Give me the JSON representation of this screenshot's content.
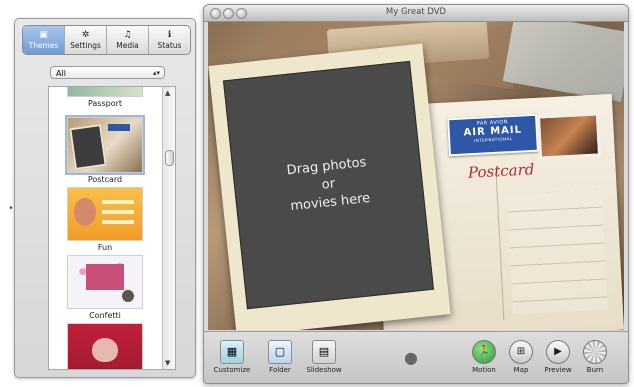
{
  "drawer": {
    "tabs": [
      {
        "label": "Themes",
        "icon": "themes-icon",
        "active": true
      },
      {
        "label": "Settings",
        "icon": "gear-icon",
        "active": false
      },
      {
        "label": "Media",
        "icon": "media-icon",
        "active": false
      },
      {
        "label": "Status",
        "icon": "info-icon",
        "active": false
      }
    ],
    "filter_value": "All",
    "themes": [
      {
        "label": "Passport"
      },
      {
        "label": "Postcard",
        "selected": true
      },
      {
        "label": "Fun"
      },
      {
        "label": "Confetti"
      },
      {
        "label": ""
      }
    ]
  },
  "window": {
    "title": "My Great DVD"
  },
  "canvas": {
    "drop_text": "Drag photos\nor\nmovies here",
    "airmail_top": "PAR AVION",
    "airmail_main": "AIR MAIL",
    "airmail_bottom": "INTERNATIONAL",
    "postcard_title": "Postcard"
  },
  "toolbar": {
    "customize": "Customize",
    "folder": "Folder",
    "slideshow": "Slideshow",
    "motion": "Motion",
    "map": "Map",
    "preview": "Preview",
    "burn": "Burn"
  },
  "colors": {
    "accent": "#6f9bd8",
    "postcard_red": "#b0292e",
    "airmail_blue": "#2f57a8",
    "motion_green": "#2e9a35"
  }
}
